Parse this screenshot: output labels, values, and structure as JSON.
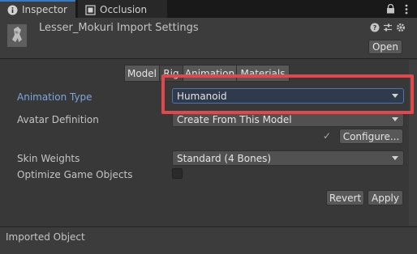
{
  "tabs": [
    {
      "label": "Inspector",
      "icon": "info-icon"
    },
    {
      "label": "Occlusion",
      "icon": "occlusion-icon"
    }
  ],
  "header": {
    "title": "Lesser_Mokuri Import Settings",
    "open_label": "Open"
  },
  "toolbar": {
    "tabs": [
      "Model",
      "Rig",
      "Animation",
      "Materials"
    ],
    "active": "Rig"
  },
  "form": {
    "animation_type": {
      "label": "Animation Type",
      "value": "Humanoid"
    },
    "avatar_definition": {
      "label": "Avatar Definition",
      "value": "Create From This Model"
    },
    "configure_label": "Configure...",
    "skin_weights": {
      "label": "Skin Weights",
      "value": "Standard (4 Bones)"
    },
    "optimize_game_objects": {
      "label": "Optimize Game Objects",
      "checked": false
    },
    "revert_label": "Revert",
    "apply_label": "Apply"
  },
  "footer": {
    "imported_object_label": "Imported Object"
  },
  "colors": {
    "highlight": "#e0484c",
    "accent_label": "#7ba7dd",
    "active_tab_indicator": "#3a79bb"
  }
}
